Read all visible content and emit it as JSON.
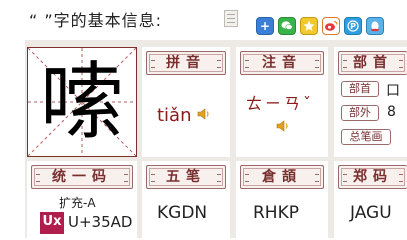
{
  "header": {
    "title": "“  ”字的基本信息:",
    "print_icon": "print-icon",
    "share_icons": [
      "add-plus-icon",
      "wechat-icon",
      "favorite-star-icon",
      "weibo-icon",
      "pinterest-icon",
      "qq-icon"
    ]
  },
  "character": {
    "glyph": "嗦"
  },
  "pinyin": {
    "label": "拼音",
    "value": "tiǎn",
    "sound_icon": "speaker-icon"
  },
  "zhuyin": {
    "label": "注音",
    "value": "ㄊㄧㄢˇ",
    "sound_icon": "speaker-icon"
  },
  "bushou": {
    "label": "部首",
    "radical_label": "部首",
    "radical_value": "口",
    "outer_label": "部外",
    "outer_value": "8",
    "total_label": "总笔画"
  },
  "unicode": {
    "label": "统一码",
    "block": "扩充-A",
    "code": "U+35AD",
    "logo_text": "Ux"
  },
  "wubi": {
    "label": "五笔",
    "value": "KGDN"
  },
  "cangjie": {
    "label": "倉頡",
    "value": "RHKP"
  },
  "zhengma": {
    "label": "郑码",
    "value": "JAGU"
  },
  "colors": {
    "accent": "#7a2f2f",
    "panel_bg": "#ede9e5",
    "pinyin_text": "#8b1a1a"
  }
}
